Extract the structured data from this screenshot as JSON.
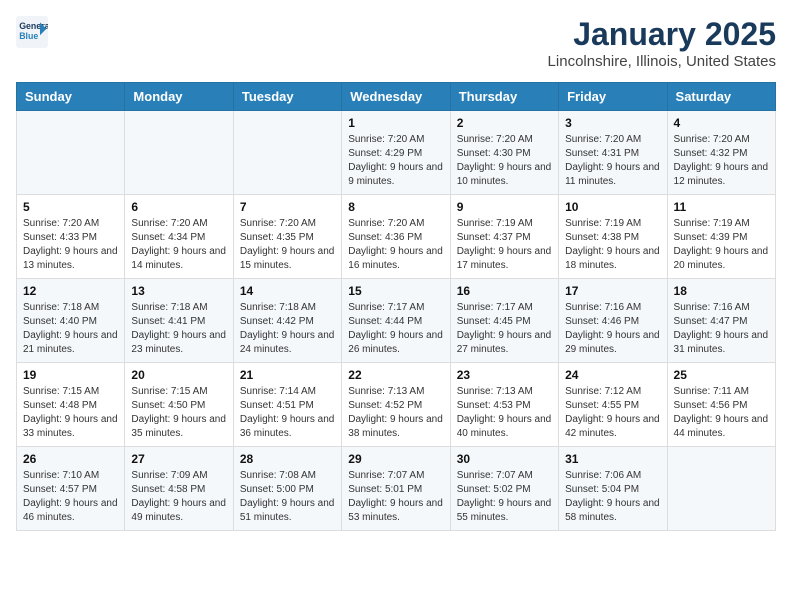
{
  "logo": {
    "line1": "General",
    "line2": "Blue"
  },
  "title": "January 2025",
  "subtitle": "Lincolnshire, Illinois, United States",
  "days_of_week": [
    "Sunday",
    "Monday",
    "Tuesday",
    "Wednesday",
    "Thursday",
    "Friday",
    "Saturday"
  ],
  "weeks": [
    [
      {
        "day": "",
        "sunrise": "",
        "sunset": "",
        "daylight": ""
      },
      {
        "day": "",
        "sunrise": "",
        "sunset": "",
        "daylight": ""
      },
      {
        "day": "",
        "sunrise": "",
        "sunset": "",
        "daylight": ""
      },
      {
        "day": "1",
        "sunrise": "Sunrise: 7:20 AM",
        "sunset": "Sunset: 4:29 PM",
        "daylight": "Daylight: 9 hours and 9 minutes."
      },
      {
        "day": "2",
        "sunrise": "Sunrise: 7:20 AM",
        "sunset": "Sunset: 4:30 PM",
        "daylight": "Daylight: 9 hours and 10 minutes."
      },
      {
        "day": "3",
        "sunrise": "Sunrise: 7:20 AM",
        "sunset": "Sunset: 4:31 PM",
        "daylight": "Daylight: 9 hours and 11 minutes."
      },
      {
        "day": "4",
        "sunrise": "Sunrise: 7:20 AM",
        "sunset": "Sunset: 4:32 PM",
        "daylight": "Daylight: 9 hours and 12 minutes."
      }
    ],
    [
      {
        "day": "5",
        "sunrise": "Sunrise: 7:20 AM",
        "sunset": "Sunset: 4:33 PM",
        "daylight": "Daylight: 9 hours and 13 minutes."
      },
      {
        "day": "6",
        "sunrise": "Sunrise: 7:20 AM",
        "sunset": "Sunset: 4:34 PM",
        "daylight": "Daylight: 9 hours and 14 minutes."
      },
      {
        "day": "7",
        "sunrise": "Sunrise: 7:20 AM",
        "sunset": "Sunset: 4:35 PM",
        "daylight": "Daylight: 9 hours and 15 minutes."
      },
      {
        "day": "8",
        "sunrise": "Sunrise: 7:20 AM",
        "sunset": "Sunset: 4:36 PM",
        "daylight": "Daylight: 9 hours and 16 minutes."
      },
      {
        "day": "9",
        "sunrise": "Sunrise: 7:19 AM",
        "sunset": "Sunset: 4:37 PM",
        "daylight": "Daylight: 9 hours and 17 minutes."
      },
      {
        "day": "10",
        "sunrise": "Sunrise: 7:19 AM",
        "sunset": "Sunset: 4:38 PM",
        "daylight": "Daylight: 9 hours and 18 minutes."
      },
      {
        "day": "11",
        "sunrise": "Sunrise: 7:19 AM",
        "sunset": "Sunset: 4:39 PM",
        "daylight": "Daylight: 9 hours and 20 minutes."
      }
    ],
    [
      {
        "day": "12",
        "sunrise": "Sunrise: 7:18 AM",
        "sunset": "Sunset: 4:40 PM",
        "daylight": "Daylight: 9 hours and 21 minutes."
      },
      {
        "day": "13",
        "sunrise": "Sunrise: 7:18 AM",
        "sunset": "Sunset: 4:41 PM",
        "daylight": "Daylight: 9 hours and 23 minutes."
      },
      {
        "day": "14",
        "sunrise": "Sunrise: 7:18 AM",
        "sunset": "Sunset: 4:42 PM",
        "daylight": "Daylight: 9 hours and 24 minutes."
      },
      {
        "day": "15",
        "sunrise": "Sunrise: 7:17 AM",
        "sunset": "Sunset: 4:44 PM",
        "daylight": "Daylight: 9 hours and 26 minutes."
      },
      {
        "day": "16",
        "sunrise": "Sunrise: 7:17 AM",
        "sunset": "Sunset: 4:45 PM",
        "daylight": "Daylight: 9 hours and 27 minutes."
      },
      {
        "day": "17",
        "sunrise": "Sunrise: 7:16 AM",
        "sunset": "Sunset: 4:46 PM",
        "daylight": "Daylight: 9 hours and 29 minutes."
      },
      {
        "day": "18",
        "sunrise": "Sunrise: 7:16 AM",
        "sunset": "Sunset: 4:47 PM",
        "daylight": "Daylight: 9 hours and 31 minutes."
      }
    ],
    [
      {
        "day": "19",
        "sunrise": "Sunrise: 7:15 AM",
        "sunset": "Sunset: 4:48 PM",
        "daylight": "Daylight: 9 hours and 33 minutes."
      },
      {
        "day": "20",
        "sunrise": "Sunrise: 7:15 AM",
        "sunset": "Sunset: 4:50 PM",
        "daylight": "Daylight: 9 hours and 35 minutes."
      },
      {
        "day": "21",
        "sunrise": "Sunrise: 7:14 AM",
        "sunset": "Sunset: 4:51 PM",
        "daylight": "Daylight: 9 hours and 36 minutes."
      },
      {
        "day": "22",
        "sunrise": "Sunrise: 7:13 AM",
        "sunset": "Sunset: 4:52 PM",
        "daylight": "Daylight: 9 hours and 38 minutes."
      },
      {
        "day": "23",
        "sunrise": "Sunrise: 7:13 AM",
        "sunset": "Sunset: 4:53 PM",
        "daylight": "Daylight: 9 hours and 40 minutes."
      },
      {
        "day": "24",
        "sunrise": "Sunrise: 7:12 AM",
        "sunset": "Sunset: 4:55 PM",
        "daylight": "Daylight: 9 hours and 42 minutes."
      },
      {
        "day": "25",
        "sunrise": "Sunrise: 7:11 AM",
        "sunset": "Sunset: 4:56 PM",
        "daylight": "Daylight: 9 hours and 44 minutes."
      }
    ],
    [
      {
        "day": "26",
        "sunrise": "Sunrise: 7:10 AM",
        "sunset": "Sunset: 4:57 PM",
        "daylight": "Daylight: 9 hours and 46 minutes."
      },
      {
        "day": "27",
        "sunrise": "Sunrise: 7:09 AM",
        "sunset": "Sunset: 4:58 PM",
        "daylight": "Daylight: 9 hours and 49 minutes."
      },
      {
        "day": "28",
        "sunrise": "Sunrise: 7:08 AM",
        "sunset": "Sunset: 5:00 PM",
        "daylight": "Daylight: 9 hours and 51 minutes."
      },
      {
        "day": "29",
        "sunrise": "Sunrise: 7:07 AM",
        "sunset": "Sunset: 5:01 PM",
        "daylight": "Daylight: 9 hours and 53 minutes."
      },
      {
        "day": "30",
        "sunrise": "Sunrise: 7:07 AM",
        "sunset": "Sunset: 5:02 PM",
        "daylight": "Daylight: 9 hours and 55 minutes."
      },
      {
        "day": "31",
        "sunrise": "Sunrise: 7:06 AM",
        "sunset": "Sunset: 5:04 PM",
        "daylight": "Daylight: 9 hours and 58 minutes."
      },
      {
        "day": "",
        "sunrise": "",
        "sunset": "",
        "daylight": ""
      }
    ]
  ]
}
